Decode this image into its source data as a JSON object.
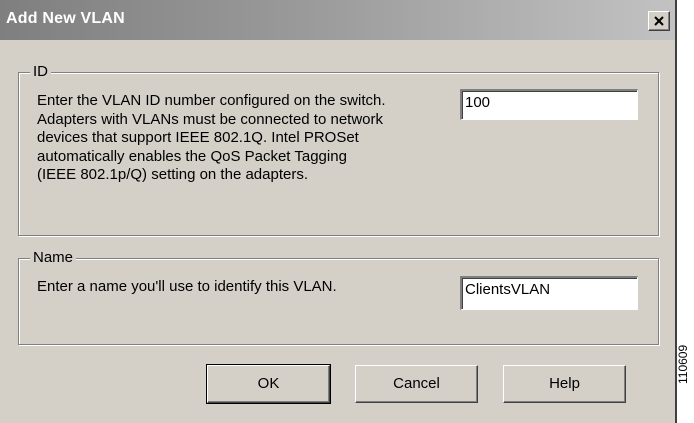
{
  "window": {
    "title": "Add New VLAN",
    "close_glyph": "close-icon"
  },
  "id_group": {
    "legend": "ID",
    "description_lines": [
      "Enter the VLAN ID number configured on the switch.",
      "Adapters with VLANs must be connected to network",
      "devices that support IEEE 802.1Q. Intel PROSet",
      "automatically enables the QoS Packet Tagging",
      "(IEEE 802.1p/Q) setting on the adapters."
    ],
    "value": "100"
  },
  "name_group": {
    "legend": "Name",
    "description": "Enter a name you'll use to identify this VLAN.",
    "value": "ClientsVLAN"
  },
  "buttons": {
    "ok": "OK",
    "cancel": "Cancel",
    "help": "Help"
  },
  "figure_number": "110609",
  "colors": {
    "dialog_face": "#d4d0c8",
    "title_gradient_start": "#7f7f7f",
    "title_gradient_end": "#c2c2c2",
    "title_text": "#ffffff"
  }
}
